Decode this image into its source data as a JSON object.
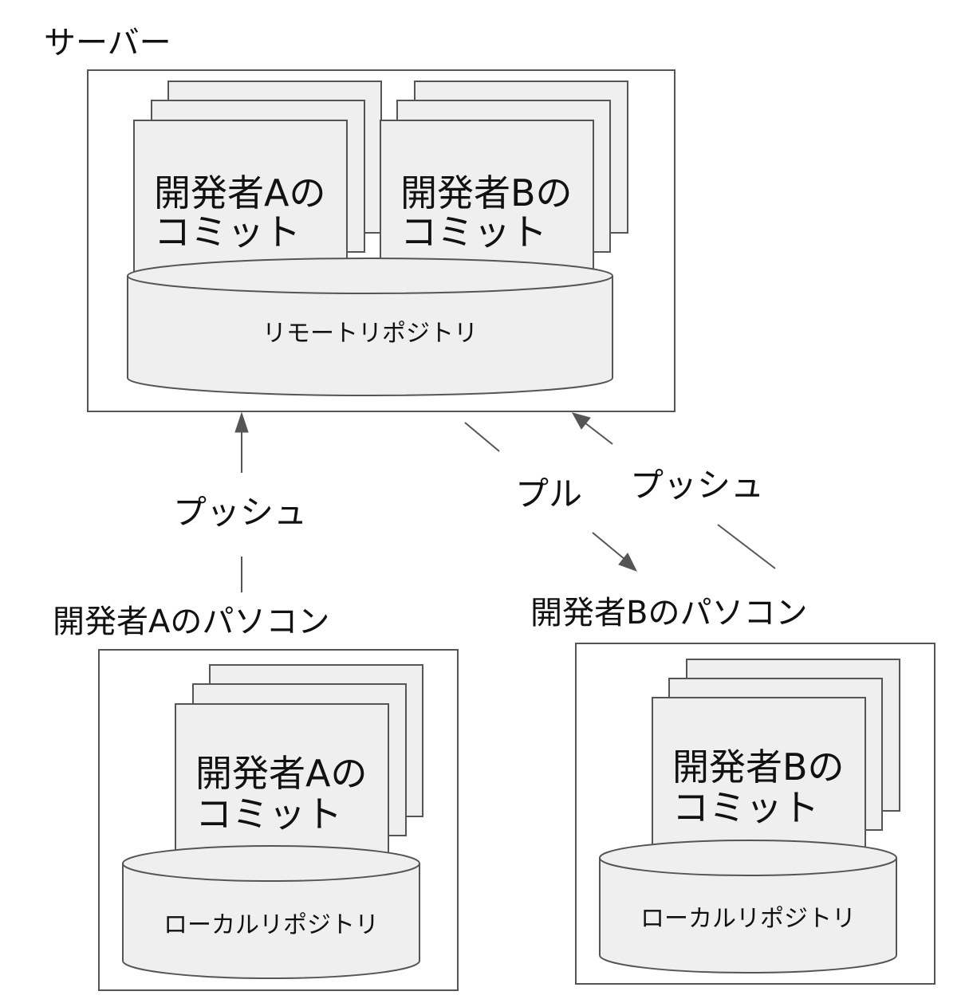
{
  "server": {
    "title": "サーバー",
    "card_a_line1": "開発者Aの",
    "card_a_line2": "コミット",
    "card_b_line1": "開発者Bの",
    "card_b_line2": "コミット",
    "repo_label": "リモートリポジトリ"
  },
  "pc_a": {
    "title": "開発者Aのパソコン",
    "card_line1": "開発者Aの",
    "card_line2": "コミット",
    "repo_label": "ローカルリポジトリ"
  },
  "pc_b": {
    "title": "開発者Bのパソコン",
    "card_line1": "開発者Bの",
    "card_line2": "コミット",
    "repo_label": "ローカルリポジトリ"
  },
  "edges": {
    "push_a": "プッシュ",
    "pull_b": "プル",
    "push_b": "プッシュ"
  },
  "colors": {
    "stroke": "#555555",
    "fill": "#efefef",
    "text": "#111111"
  }
}
